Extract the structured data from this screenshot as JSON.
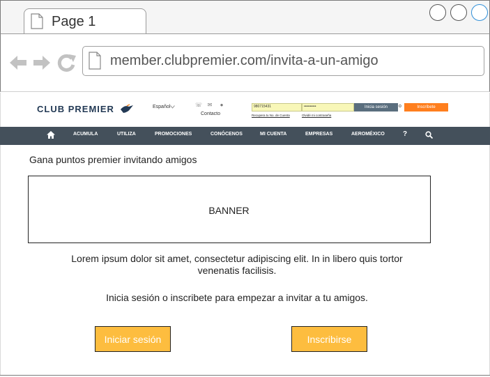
{
  "browser": {
    "tab_title": "Page 1",
    "url": "member.clubpremier.com/invita-a-un-amigo"
  },
  "site": {
    "logo_text": "CLUB PREMIER",
    "language": "Español",
    "contact_label": "Contacto",
    "account_number_value": "980715431",
    "password_value": "••••••••••",
    "forgot_account_link": "Recupera tu No. de Cuenta",
    "forgot_password_link": "Olvidé mi contraseña",
    "login_label": "Inicia sesión",
    "or_label": "o",
    "register_label": "Inscríbete"
  },
  "nav": {
    "items": [
      "ACUMULA",
      "UTILIZA",
      "PROMOCIONES",
      "CONÓCENOS",
      "MI CUENTA",
      "EMPRESAS",
      "AEROMÉXICO",
      "?"
    ]
  },
  "content": {
    "title": "Gana puntos premier invitando amigos",
    "banner_label": "BANNER",
    "lorem": "Lorem ipsum dolor sit amet, consectetur adipiscing elit. In in libero quis tortor venenatis facilisis.",
    "prompt": "Inicia sesión o inscribete para empezar a invitar a tu amigos.",
    "login_button": "Iniciar sesión",
    "register_button": "Inscribirse"
  },
  "colors": {
    "nav_bg": "#44505b",
    "cta_bg": "#fdbd3f",
    "register_bg": "#ff7f1e",
    "login_bg": "#5a6e7e"
  }
}
